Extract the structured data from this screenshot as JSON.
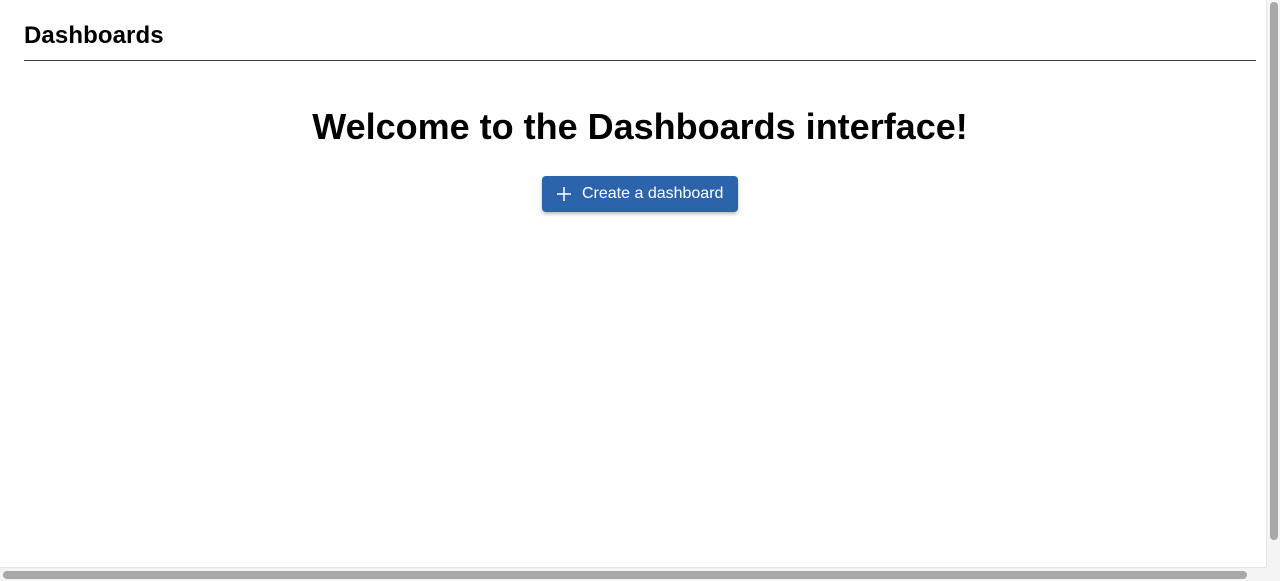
{
  "header": {
    "title": "Dashboards"
  },
  "main": {
    "welcome_text": "Welcome to the Dashboards interface!",
    "create_button": {
      "label": "Create a dashboard",
      "icon": "plus-icon"
    }
  },
  "colors": {
    "accent": "#2c64ab",
    "text": "#000000",
    "divider": "#444444"
  }
}
